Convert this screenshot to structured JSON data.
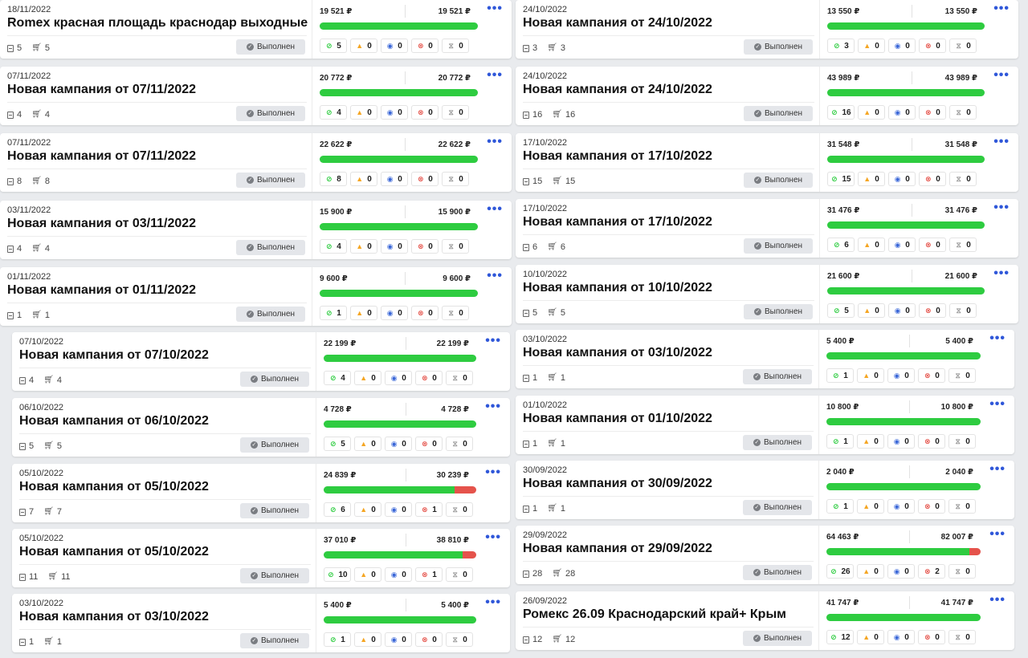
{
  "labels": {
    "status_done": "Выполнен"
  },
  "icons": {
    "positions": "list-icon",
    "orders": "cart-icon",
    "status": "check-circle-icon",
    "menu": "more-dots-icon",
    "done": "check-circle-icon",
    "like": "thumb-icon",
    "in_progress": "target-icon",
    "cancelled": "x-circle-icon",
    "waiting": "hourglass-icon"
  },
  "colors": {
    "progress_done": "#2ecc40",
    "progress_fail": "#e5534b",
    "accent": "#2f57d9"
  },
  "campaigns": [
    {
      "date": "18/11/2022",
      "title": "Romex красная площадь краснодар выходные",
      "positions": "5",
      "orders": "5",
      "sum_left": "19 521 ₽",
      "sum_right": "19 521 ₽",
      "progress": 1,
      "stats": [
        "5",
        "0",
        "0",
        "0",
        "0"
      ]
    },
    {
      "date": "07/11/2022",
      "title": "Новая кампания от 07/11/2022",
      "positions": "4",
      "orders": "4",
      "sum_left": "20 772 ₽",
      "sum_right": "20 772 ₽",
      "progress": 1,
      "stats": [
        "4",
        "0",
        "0",
        "0",
        "0"
      ]
    },
    {
      "date": "07/11/2022",
      "title": "Новая кампания от 07/11/2022",
      "positions": "8",
      "orders": "8",
      "sum_left": "22 622 ₽",
      "sum_right": "22 622 ₽",
      "progress": 1,
      "stats": [
        "8",
        "0",
        "0",
        "0",
        "0"
      ]
    },
    {
      "date": "03/11/2022",
      "title": "Новая кампания от 03/11/2022",
      "positions": "4",
      "orders": "4",
      "sum_left": "15 900 ₽",
      "sum_right": "15 900 ₽",
      "progress": 1,
      "stats": [
        "4",
        "0",
        "0",
        "0",
        "0"
      ]
    },
    {
      "date": "01/11/2022",
      "title": "Новая кампания от 01/11/2022",
      "positions": "1",
      "orders": "1",
      "sum_left": "9 600 ₽",
      "sum_right": "9 600 ₽",
      "progress": 1,
      "stats": [
        "1",
        "0",
        "0",
        "0",
        "0"
      ]
    },
    {
      "date": "07/10/2022",
      "title": "Новая кампания от 07/10/2022",
      "positions": "4",
      "orders": "4",
      "sum_left": "22 199 ₽",
      "sum_right": "22 199 ₽",
      "progress": 1,
      "stats": [
        "4",
        "0",
        "0",
        "0",
        "0"
      ]
    },
    {
      "date": "06/10/2022",
      "title": "Новая кампания от 06/10/2022",
      "positions": "5",
      "orders": "5",
      "sum_left": "4 728 ₽",
      "sum_right": "4 728 ₽",
      "progress": 1,
      "stats": [
        "5",
        "0",
        "0",
        "0",
        "0"
      ]
    },
    {
      "date": "05/10/2022",
      "title": "Новая кампания от 05/10/2022",
      "positions": "7",
      "orders": "7",
      "sum_left": "24 839 ₽",
      "sum_right": "30 239 ₽",
      "progress": 0.857,
      "stats": [
        "6",
        "0",
        "0",
        "1",
        "0"
      ]
    },
    {
      "date": "05/10/2022",
      "title": "Новая кампания от 05/10/2022",
      "positions": "11",
      "orders": "11",
      "sum_left": "37 010 ₽",
      "sum_right": "38 810 ₽",
      "progress": 0.909,
      "stats": [
        "10",
        "0",
        "0",
        "1",
        "0"
      ]
    },
    {
      "date": "03/10/2022",
      "title": "Новая кампания от 03/10/2022",
      "positions": "1",
      "orders": "1",
      "sum_left": "5 400 ₽",
      "sum_right": "5 400 ₽",
      "progress": 1,
      "stats": [
        "1",
        "0",
        "0",
        "0",
        "0"
      ]
    },
    {
      "date": "24/10/2022",
      "title": "Новая кампания от 24/10/2022",
      "positions": "3",
      "orders": "3",
      "sum_left": "13 550 ₽",
      "sum_right": "13 550 ₽",
      "progress": 1,
      "stats": [
        "3",
        "0",
        "0",
        "0",
        "0"
      ]
    },
    {
      "date": "24/10/2022",
      "title": "Новая кампания от 24/10/2022",
      "positions": "16",
      "orders": "16",
      "sum_left": "43 989 ₽",
      "sum_right": "43 989 ₽",
      "progress": 1,
      "stats": [
        "16",
        "0",
        "0",
        "0",
        "0"
      ]
    },
    {
      "date": "17/10/2022",
      "title": "Новая кампания от 17/10/2022",
      "positions": "15",
      "orders": "15",
      "sum_left": "31 548 ₽",
      "sum_right": "31 548 ₽",
      "progress": 1,
      "stats": [
        "15",
        "0",
        "0",
        "0",
        "0"
      ]
    },
    {
      "date": "17/10/2022",
      "title": "Новая кампания от 17/10/2022",
      "positions": "6",
      "orders": "6",
      "sum_left": "31 476 ₽",
      "sum_right": "31 476 ₽",
      "progress": 1,
      "stats": [
        "6",
        "0",
        "0",
        "0",
        "0"
      ]
    },
    {
      "date": "10/10/2022",
      "title": "Новая кампания от 10/10/2022",
      "positions": "5",
      "orders": "5",
      "sum_left": "21 600 ₽",
      "sum_right": "21 600 ₽",
      "progress": 1,
      "stats": [
        "5",
        "0",
        "0",
        "0",
        "0"
      ]
    },
    {
      "date": "03/10/2022",
      "title": "Новая кампания от 03/10/2022",
      "positions": "1",
      "orders": "1",
      "sum_left": "5 400 ₽",
      "sum_right": "5 400 ₽",
      "progress": 1,
      "stats": [
        "1",
        "0",
        "0",
        "0",
        "0"
      ]
    },
    {
      "date": "01/10/2022",
      "title": "Новая кампания от 01/10/2022",
      "positions": "1",
      "orders": "1",
      "sum_left": "10 800 ₽",
      "sum_right": "10 800 ₽",
      "progress": 1,
      "stats": [
        "1",
        "0",
        "0",
        "0",
        "0"
      ]
    },
    {
      "date": "30/09/2022",
      "title": "Новая кампания от 30/09/2022",
      "positions": "1",
      "orders": "1",
      "sum_left": "2 040 ₽",
      "sum_right": "2 040 ₽",
      "progress": 1,
      "stats": [
        "1",
        "0",
        "0",
        "0",
        "0"
      ]
    },
    {
      "date": "29/09/2022",
      "title": "Новая кампания от 29/09/2022",
      "positions": "28",
      "orders": "28",
      "sum_left": "64 463 ₽",
      "sum_right": "82 007 ₽",
      "progress": 0.929,
      "stats": [
        "26",
        "0",
        "0",
        "2",
        "0"
      ]
    },
    {
      "date": "26/09/2022",
      "title": "Ромекс 26.09 Краснодарский край+ Крым",
      "positions": "12",
      "orders": "12",
      "sum_left": "41 747 ₽",
      "sum_right": "41 747 ₽",
      "progress": 1,
      "stats": [
        "12",
        "0",
        "0",
        "0",
        "0"
      ]
    }
  ]
}
